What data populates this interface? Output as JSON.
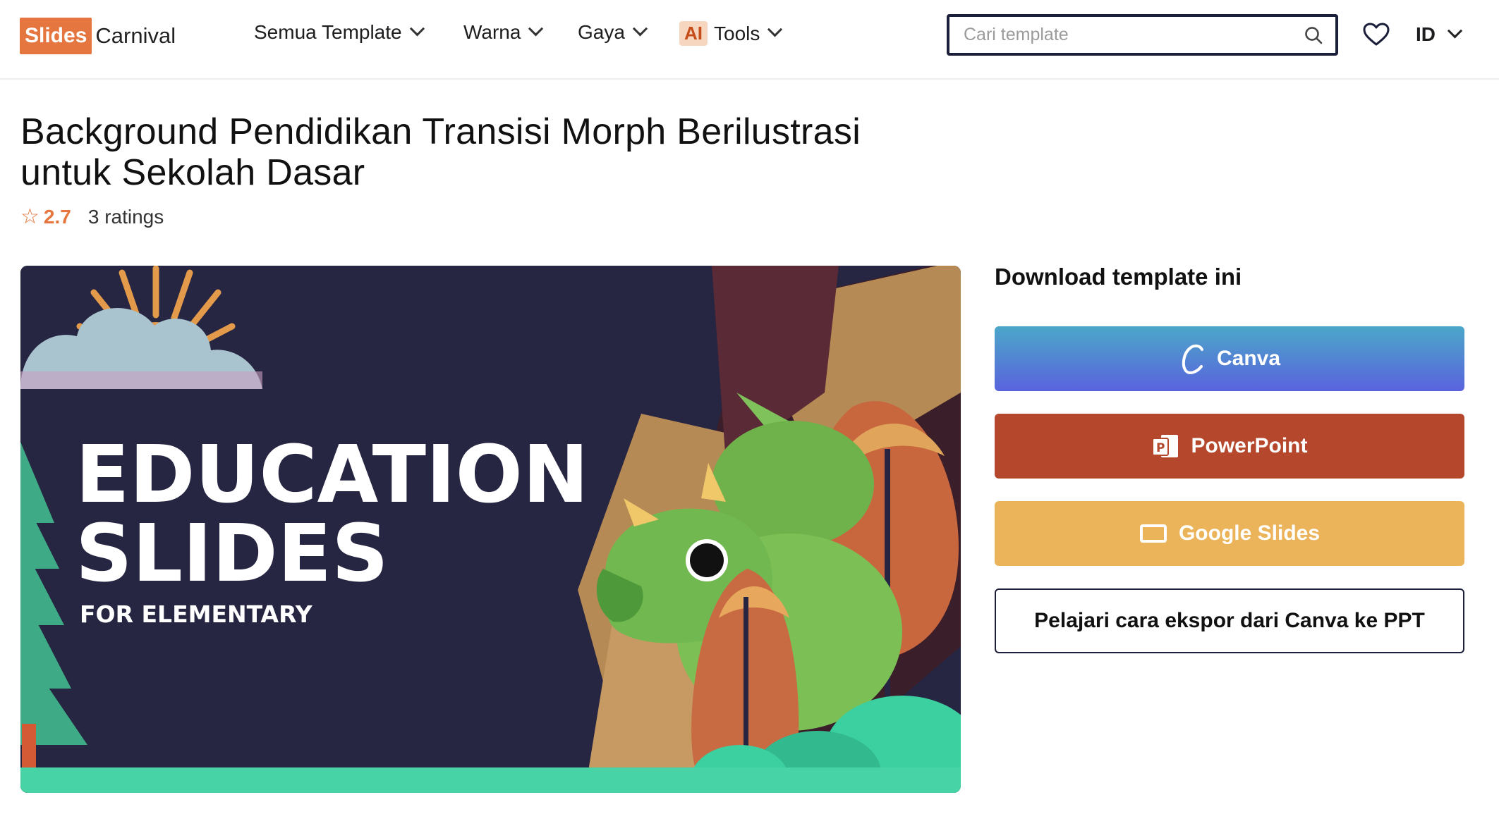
{
  "header": {
    "logo_box": "Slides",
    "logo_text": "Carnival",
    "nav": [
      {
        "label": "Semua Template"
      },
      {
        "label": "Warna"
      },
      {
        "label": "Gaya"
      },
      {
        "badge": "AI",
        "label": "Tools"
      }
    ],
    "search_placeholder": "Cari template",
    "language": "ID"
  },
  "page": {
    "title_line1": "Background Pendidikan Transisi Morph Berilustrasi",
    "title_line2": "untuk Sekolah Dasar",
    "rating_score": "2.7",
    "rating_count": "3 ratings"
  },
  "preview": {
    "heading_line1": "EDUCATION",
    "heading_line2": "SLIDES",
    "subheading": "FOR ELEMENTARY"
  },
  "download": {
    "title": "Download template ini",
    "canva": "Canva",
    "powerpoint": "PowerPoint",
    "google_slides": "Google Slides",
    "learn_export": "Pelajari cara ekspor dari Canva ke PPT"
  },
  "colors": {
    "accent": "#e6763f",
    "canva_top": "#4ba7c9",
    "canva_bottom": "#5a63dd",
    "powerpoint": "#b5472c",
    "google_slides": "#ebb45a",
    "preview_bg": "#262542"
  }
}
